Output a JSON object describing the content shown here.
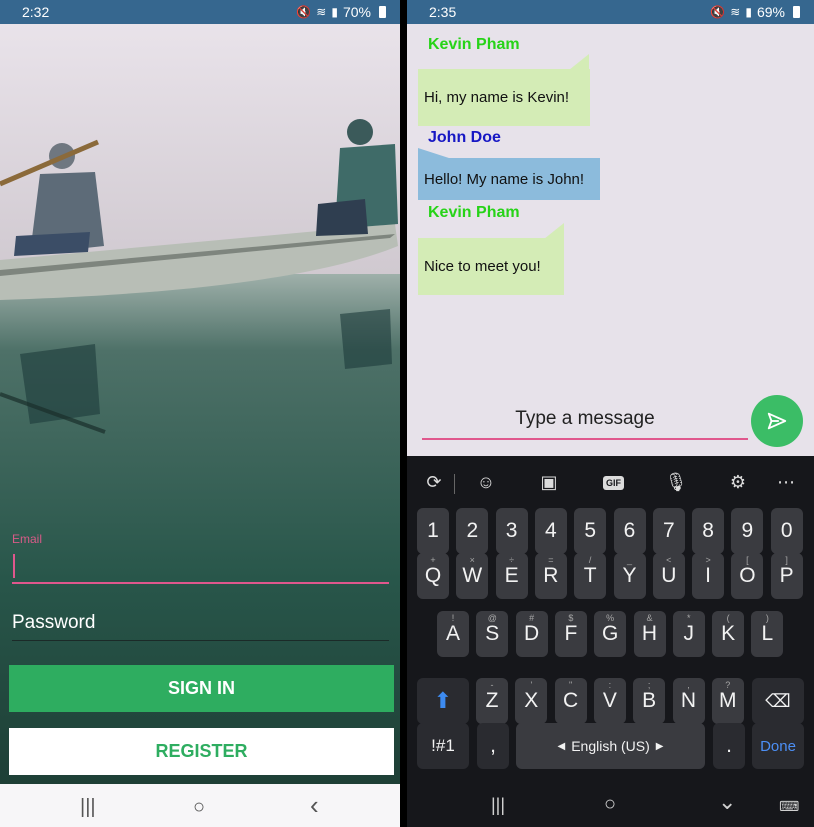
{
  "left": {
    "status": {
      "time": "2:32",
      "battery": "70%"
    },
    "form": {
      "email_label": "Email",
      "email_value": "",
      "password_placeholder": "Password",
      "signin_label": "SIGN IN",
      "register_label": "REGISTER"
    },
    "nav": {
      "recents": "|||",
      "home": "○",
      "back": "‹"
    }
  },
  "right": {
    "status": {
      "time": "2:35",
      "battery": "69%"
    },
    "messages": [
      {
        "sender": "Kevin Pham",
        "text": "Hi, my name is Kevin!"
      },
      {
        "sender": "John Doe",
        "text": "Hello! My name is John!"
      },
      {
        "sender": "Kevin Pham",
        "text": "Nice to meet you!"
      }
    ],
    "composer": {
      "placeholder": "Type a message"
    },
    "keyboard": {
      "numbers": [
        "1",
        "2",
        "3",
        "4",
        "5",
        "6",
        "7",
        "8",
        "9",
        "0"
      ],
      "row1": [
        {
          "k": "Q",
          "h": "+"
        },
        {
          "k": "W",
          "h": "×"
        },
        {
          "k": "E",
          "h": "÷"
        },
        {
          "k": "R",
          "h": "="
        },
        {
          "k": "T",
          "h": "/"
        },
        {
          "k": "Y",
          "h": "_"
        },
        {
          "k": "U",
          "h": "<"
        },
        {
          "k": "I",
          "h": ">"
        },
        {
          "k": "O",
          "h": "["
        },
        {
          "k": "P",
          "h": "]"
        }
      ],
      "row2": [
        {
          "k": "A",
          "h": "!"
        },
        {
          "k": "S",
          "h": "@"
        },
        {
          "k": "D",
          "h": "#"
        },
        {
          "k": "F",
          "h": "$"
        },
        {
          "k": "G",
          "h": "%"
        },
        {
          "k": "H",
          "h": "&"
        },
        {
          "k": "J",
          "h": "*"
        },
        {
          "k": "K",
          "h": "("
        },
        {
          "k": "L",
          "h": ")"
        }
      ],
      "row3": [
        {
          "k": "Z",
          "h": "-"
        },
        {
          "k": "X",
          "h": "'"
        },
        {
          "k": "C",
          "h": "\""
        },
        {
          "k": "V",
          "h": ":"
        },
        {
          "k": "B",
          "h": ";"
        },
        {
          "k": "N",
          "h": ","
        },
        {
          "k": "M",
          "h": "?"
        }
      ],
      "symbols_label": "!#1",
      "comma": ",",
      "space_label": "English (US)",
      "period": ".",
      "done_label": "Done",
      "gif_label": "GIF"
    },
    "nav": {
      "recents": "|||",
      "home": "○",
      "back": "⌄"
    }
  },
  "colors": {
    "status_bar": "#36678f",
    "accent_green": "#2ead60",
    "accent_pink": "#e0578d",
    "kevin_name": "#27d318",
    "john_name": "#1717c4",
    "bubble_green": "#d4ecb6",
    "bubble_blue": "#8cbbdc"
  }
}
